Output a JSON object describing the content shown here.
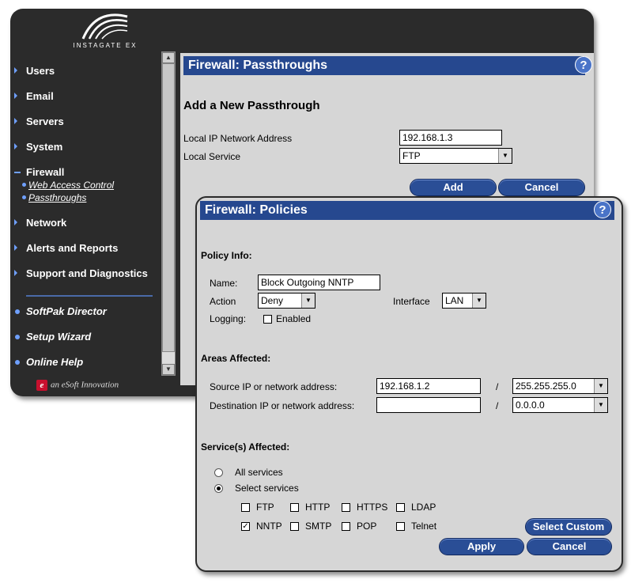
{
  "app": {
    "logo_text": "INSTAGATE EX",
    "footer_text": "an eSoft Innovation"
  },
  "sidebar": {
    "items": [
      {
        "label": "Users"
      },
      {
        "label": "Email"
      },
      {
        "label": "Servers"
      },
      {
        "label": "System"
      },
      {
        "label": "Firewall"
      },
      {
        "label": "Network"
      },
      {
        "label": "Alerts and Reports"
      },
      {
        "label": "Support and Diagnostics"
      }
    ],
    "firewall_sub": [
      {
        "label": "Web Access Control"
      },
      {
        "label": "Passthroughs"
      }
    ],
    "extras": [
      {
        "label": "SoftPak Director"
      },
      {
        "label": "Setup Wizard"
      },
      {
        "label": "Online Help"
      }
    ]
  },
  "passthroughs": {
    "title": "Firewall: Passthroughs",
    "help": "?",
    "heading": "Add a New Passthrough",
    "local_ip_label": "Local IP Network Address",
    "local_ip_value": "192.168.1.3",
    "local_service_label": "Local Service",
    "local_service_value": "FTP",
    "add_label": "Add",
    "cancel_label": "Cancel"
  },
  "policies": {
    "title": "Firewall: Policies",
    "help": "?",
    "policy_info_heading": "Policy Info:",
    "name_label": "Name:",
    "name_value": "Block Outgoing NNTP",
    "action_label": "Action",
    "action_value": "Deny",
    "interface_label": "Interface",
    "interface_value": "LAN",
    "logging_label": "Logging:",
    "logging_enabled_label": "Enabled",
    "logging_enabled": false,
    "areas_heading": "Areas Affected:",
    "source_label": "Source IP or network address:",
    "source_value": "192.168.1.2",
    "source_mask": "255.255.255.0",
    "dest_label": "Destination IP or network address:",
    "dest_value": "",
    "dest_mask": "0.0.0.0",
    "slash": "/",
    "services_heading": "Service(s) Affected:",
    "all_services_label": "All services",
    "select_services_label": "Select services",
    "selected_radio": "select",
    "services": [
      {
        "label": "FTP",
        "checked": false
      },
      {
        "label": "HTTP",
        "checked": false
      },
      {
        "label": "HTTPS",
        "checked": false
      },
      {
        "label": "LDAP",
        "checked": false
      },
      {
        "label": "NNTP",
        "checked": true
      },
      {
        "label": "SMTP",
        "checked": false
      },
      {
        "label": "POP",
        "checked": false
      },
      {
        "label": "Telnet",
        "checked": false
      }
    ],
    "select_custom_label": "Select Custom",
    "apply_label": "Apply",
    "cancel_label": "Cancel"
  },
  "colors": {
    "titlebar": "#26488f",
    "button": "#2a4e96",
    "sidebar_bg": "#2b2b2b",
    "panel_bg": "#d6d6d6",
    "accent": "#6fa0ff"
  },
  "icons": {
    "check": "✓",
    "dropdown": "▼",
    "scroll_up": "▲",
    "scroll_down": "▼"
  }
}
